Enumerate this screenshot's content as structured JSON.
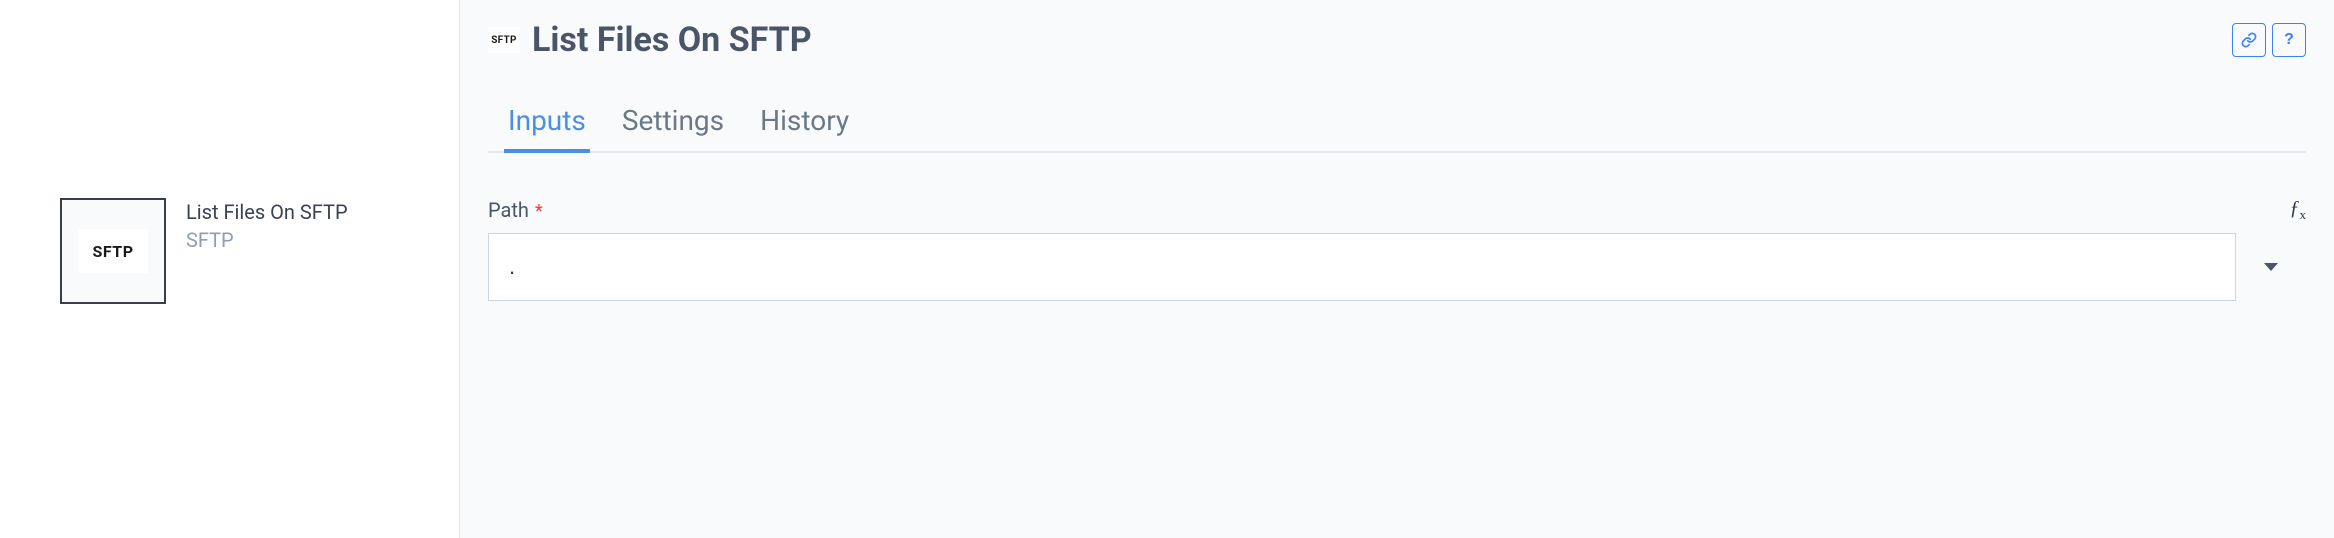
{
  "node": {
    "badge": "SFTP",
    "title": "List Files On SFTP",
    "subtitle": "SFTP"
  },
  "header": {
    "badge": "SFTP",
    "title": "List Files On SFTP"
  },
  "tabs": {
    "items": [
      {
        "label": "Inputs",
        "active": true
      },
      {
        "label": "Settings",
        "active": false
      },
      {
        "label": "History",
        "active": false
      }
    ]
  },
  "form": {
    "path": {
      "label": "Path",
      "required": "*",
      "value": ".",
      "fx": "ƒ"
    }
  },
  "actions": {
    "help": "?"
  }
}
